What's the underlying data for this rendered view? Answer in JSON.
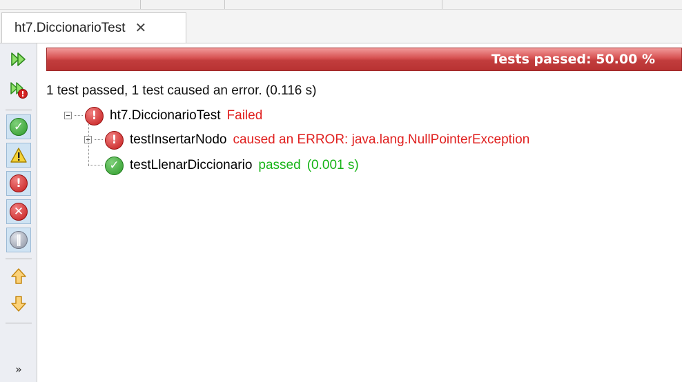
{
  "tab": {
    "title": "ht7.DiccionarioTest",
    "close_glyph": "✕"
  },
  "progress": {
    "label": "Tests passed: 50.00 %",
    "fraction": 0.5,
    "color": "#d65050"
  },
  "summary": "1 test passed, 1 test caused an error. (0.116 s)",
  "tree": {
    "root": {
      "name": "ht7.DiccionarioTest",
      "status": "Failed",
      "icon": "error-icon"
    },
    "children": [
      {
        "name": "testInsertarNodo",
        "status": "caused an ERROR: java.lang.NullPointerException",
        "icon": "error-icon",
        "color": "#e0201f"
      },
      {
        "name": "testLlenarDiccionario",
        "status": "passed",
        "time": "(0.001 s)",
        "icon": "passed-icon",
        "color": "#16b416"
      }
    ]
  },
  "toolbar": {
    "buttons": [
      "rerun-icon",
      "rerun-failed-icon",
      "show-passed-icon",
      "show-warnings-icon",
      "show-failures-icon",
      "show-errors-icon",
      "show-aborted-icon",
      "previous-failure-icon",
      "next-failure-icon"
    ],
    "more": "»"
  }
}
